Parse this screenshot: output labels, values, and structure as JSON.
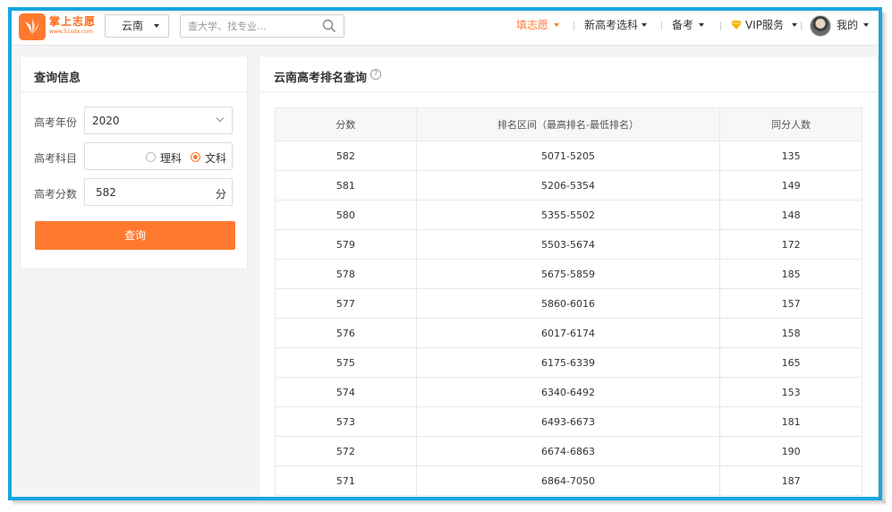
{
  "header": {
    "brand": "掌上志愿",
    "brand_url": "www.51sdx.com",
    "province": "云南",
    "search_placeholder": "查大学、找专业...",
    "nav": [
      {
        "label": "填志愿"
      },
      {
        "label": "新高考选科"
      },
      {
        "label": "备考"
      },
      {
        "label": "VIP服务"
      },
      {
        "label": "我的"
      }
    ]
  },
  "query_panel": {
    "title": "查询信息",
    "year_label": "高考年份",
    "year_value": "2020",
    "subject_label": "高考科目",
    "subject_options": [
      "理科",
      "文科"
    ],
    "subject_selected": "文科",
    "score_label": "高考分数",
    "score_value": "582",
    "score_unit": "分",
    "query_button": "查询"
  },
  "results_panel": {
    "title": "云南高考排名查询",
    "help_glyph": "?",
    "columns": [
      "分数",
      "排名区间（最高排名-最低排名）",
      "同分人数"
    ],
    "rows": [
      [
        "582",
        "5071-5205",
        "135"
      ],
      [
        "581",
        "5206-5354",
        "149"
      ],
      [
        "580",
        "5355-5502",
        "148"
      ],
      [
        "579",
        "5503-5674",
        "172"
      ],
      [
        "578",
        "5675-5859",
        "185"
      ],
      [
        "577",
        "5860-6016",
        "157"
      ],
      [
        "576",
        "6017-6174",
        "158"
      ],
      [
        "575",
        "6175-6339",
        "165"
      ],
      [
        "574",
        "6340-6492",
        "153"
      ],
      [
        "573",
        "6493-6673",
        "181"
      ],
      [
        "572",
        "6674-6863",
        "190"
      ],
      [
        "571",
        "6864-7050",
        "187"
      ]
    ]
  },
  "colors": {
    "accent": "#ff7a2f",
    "frame": "#18a6e0",
    "vip_diamond": "#f5b400"
  }
}
